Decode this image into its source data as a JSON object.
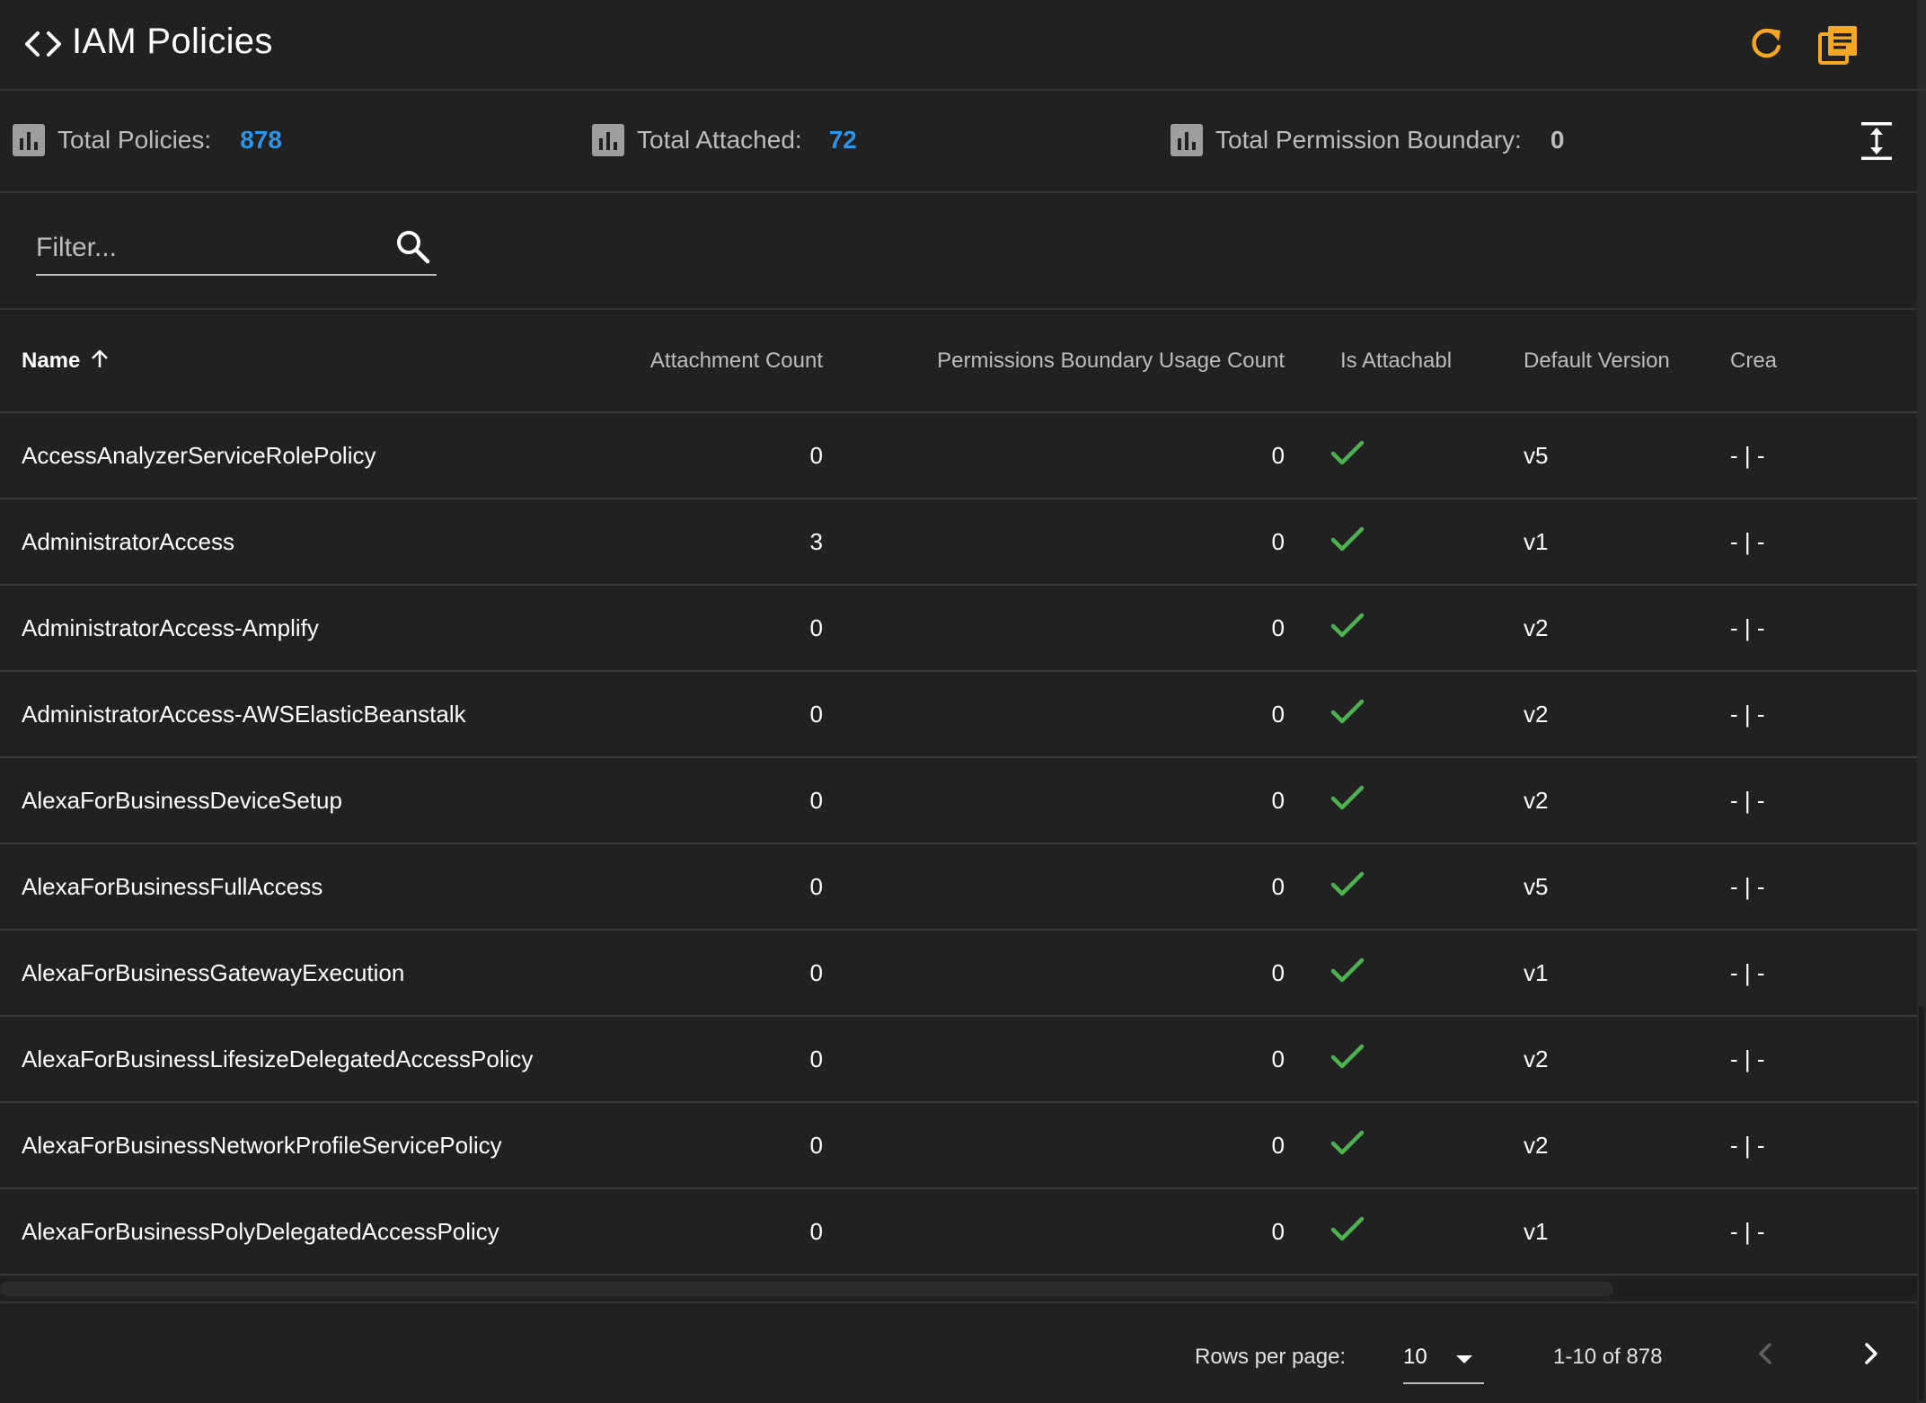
{
  "header": {
    "title": "IAM Policies",
    "icon": "code-icon",
    "actions": [
      {
        "name": "refresh",
        "icon": "refresh-icon"
      },
      {
        "name": "docs",
        "icon": "docs-icon"
      }
    ]
  },
  "stats": {
    "total_policies_label": "Total Policies:",
    "total_policies_value": "878",
    "total_attached_label": "Total Attached:",
    "total_attached_value": "72",
    "total_boundary_label": "Total Permission Boundary:",
    "total_boundary_value": "0"
  },
  "filter": {
    "placeholder": "Filter...",
    "value": ""
  },
  "table": {
    "columns": [
      "Name",
      "Attachment Count",
      "Permissions Boundary Usage Count",
      "Is Attachable",
      "Default Version",
      "Crea"
    ],
    "sort": {
      "column": "Name",
      "direction": "asc"
    },
    "rows": [
      {
        "name": "AccessAnalyzerServiceRolePolicy",
        "attachment_count": "0",
        "boundary_count": "0",
        "is_attachable": true,
        "default_version": "v5",
        "created": "- | -"
      },
      {
        "name": "AdministratorAccess",
        "attachment_count": "3",
        "boundary_count": "0",
        "is_attachable": true,
        "default_version": "v1",
        "created": "- | -"
      },
      {
        "name": "AdministratorAccess-Amplify",
        "attachment_count": "0",
        "boundary_count": "0",
        "is_attachable": true,
        "default_version": "v2",
        "created": "- | -"
      },
      {
        "name": "AdministratorAccess-AWSElasticBeanstalk",
        "attachment_count": "0",
        "boundary_count": "0",
        "is_attachable": true,
        "default_version": "v2",
        "created": "- | -"
      },
      {
        "name": "AlexaForBusinessDeviceSetup",
        "attachment_count": "0",
        "boundary_count": "0",
        "is_attachable": true,
        "default_version": "v2",
        "created": "- | -"
      },
      {
        "name": "AlexaForBusinessFullAccess",
        "attachment_count": "0",
        "boundary_count": "0",
        "is_attachable": true,
        "default_version": "v5",
        "created": "- | -"
      },
      {
        "name": "AlexaForBusinessGatewayExecution",
        "attachment_count": "0",
        "boundary_count": "0",
        "is_attachable": true,
        "default_version": "v1",
        "created": "- | -"
      },
      {
        "name": "AlexaForBusinessLifesizeDelegatedAccessPolicy",
        "attachment_count": "0",
        "boundary_count": "0",
        "is_attachable": true,
        "default_version": "v2",
        "created": "- | -"
      },
      {
        "name": "AlexaForBusinessNetworkProfileServicePolicy",
        "attachment_count": "0",
        "boundary_count": "0",
        "is_attachable": true,
        "default_version": "v2",
        "created": "- | -"
      },
      {
        "name": "AlexaForBusinessPolyDelegatedAccessPolicy",
        "attachment_count": "0",
        "boundary_count": "0",
        "is_attachable": true,
        "default_version": "v1",
        "created": "- | -"
      }
    ]
  },
  "pagination": {
    "rows_per_page_label": "Rows per page:",
    "rows_per_page_value": "10",
    "range_text": "1-10 of 878"
  },
  "colors": {
    "background": "#212121",
    "accent_orange": "#f5a623",
    "value_blue": "#2f93e6",
    "check_green": "#4caf50",
    "divider": "#333333"
  }
}
